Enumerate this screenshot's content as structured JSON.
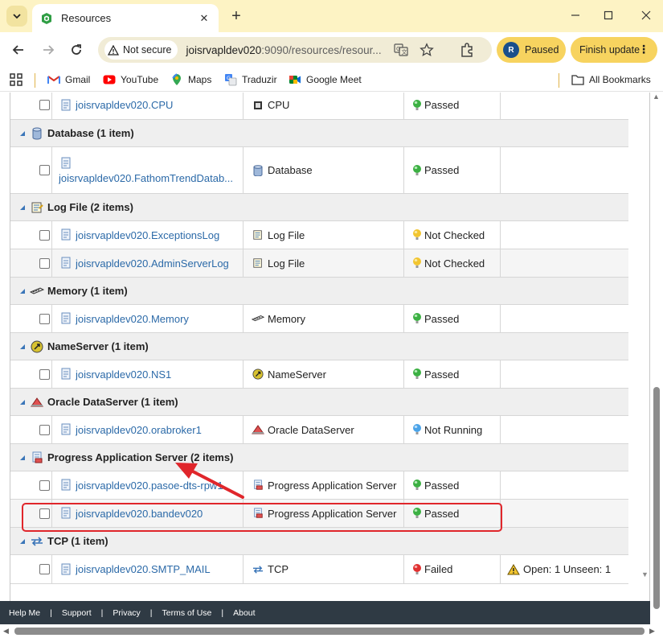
{
  "browser": {
    "tab_title": "Resources",
    "secure_label": "Not secure",
    "url_host": "joisrvapldev020",
    "url_rest": ":9090/resources/resour...",
    "profile_initial": "R",
    "paused_label": "Paused",
    "update_label": "Finish update",
    "bookmarks": [
      {
        "label": "Gmail",
        "icon": "gmail-icon"
      },
      {
        "label": "YouTube",
        "icon": "youtube-icon"
      },
      {
        "label": "Maps",
        "icon": "maps-icon"
      },
      {
        "label": "Traduzir",
        "icon": "translate-icon"
      },
      {
        "label": "Google Meet",
        "icon": "meet-icon"
      }
    ],
    "all_bookmarks_label": "All Bookmarks"
  },
  "resources": {
    "cpu_row": {
      "name": "joisrvapldev020.CPU",
      "type": "CPU",
      "status": "Passed"
    },
    "groups": [
      {
        "label": "Database (1 item)",
        "icon": "database-icon",
        "items": [
          {
            "name": "joisrvapldev020.FathomTrendDatab...",
            "type": "Database",
            "status": "Passed",
            "status_color": "green"
          }
        ]
      },
      {
        "label": "Log File (2 items)",
        "icon": "log-file-icon",
        "items": [
          {
            "name": "joisrvapldev020.ExceptionsLog",
            "type": "Log File",
            "status": "Not Checked",
            "status_color": "yellow"
          },
          {
            "name": "joisrvapldev020.AdminServerLog",
            "type": "Log File",
            "status": "Not Checked",
            "status_color": "yellow"
          }
        ]
      },
      {
        "label": "Memory (1 item)",
        "icon": "memory-icon",
        "items": [
          {
            "name": "joisrvapldev020.Memory",
            "type": "Memory",
            "status": "Passed",
            "status_color": "green"
          }
        ]
      },
      {
        "label": "NameServer (1 item)",
        "icon": "nameserver-icon",
        "items": [
          {
            "name": "joisrvapldev020.NS1",
            "type": "NameServer",
            "status": "Passed",
            "status_color": "green"
          }
        ]
      },
      {
        "label": "Oracle DataServer (1 item)",
        "icon": "oracle-dataserver-icon",
        "items": [
          {
            "name": "joisrvapldev020.orabroker1",
            "type": "Oracle DataServer",
            "status": "Not Running",
            "status_color": "blue"
          }
        ]
      },
      {
        "label": "Progress Application Server (2 items)",
        "icon": "app-server-icon",
        "items": [
          {
            "name": "joisrvapldev020.pasoe-dts-rpw1",
            "type": "Progress Application Server",
            "status": "Passed",
            "status_color": "green"
          },
          {
            "name": "joisrvapldev020.bandev020",
            "type": "Progress Application Server",
            "status": "Passed",
            "status_color": "green"
          }
        ]
      },
      {
        "label": "TCP (1 item)",
        "icon": "tcp-icon",
        "items": [
          {
            "name": "joisrvapldev020.SMTP_MAIL",
            "type": "TCP",
            "status": "Failed",
            "status_color": "red",
            "alert": "Open: 1 Unseen: 1"
          }
        ]
      }
    ]
  },
  "colors": {
    "green": "#3cb043",
    "yellow": "#f2c530",
    "blue": "#4aa3e8",
    "red": "#e03030",
    "highlight": "#e0262b"
  },
  "footer": {
    "links": [
      "Help Me",
      "Support",
      "Privacy",
      "Terms of Use",
      "About"
    ]
  }
}
